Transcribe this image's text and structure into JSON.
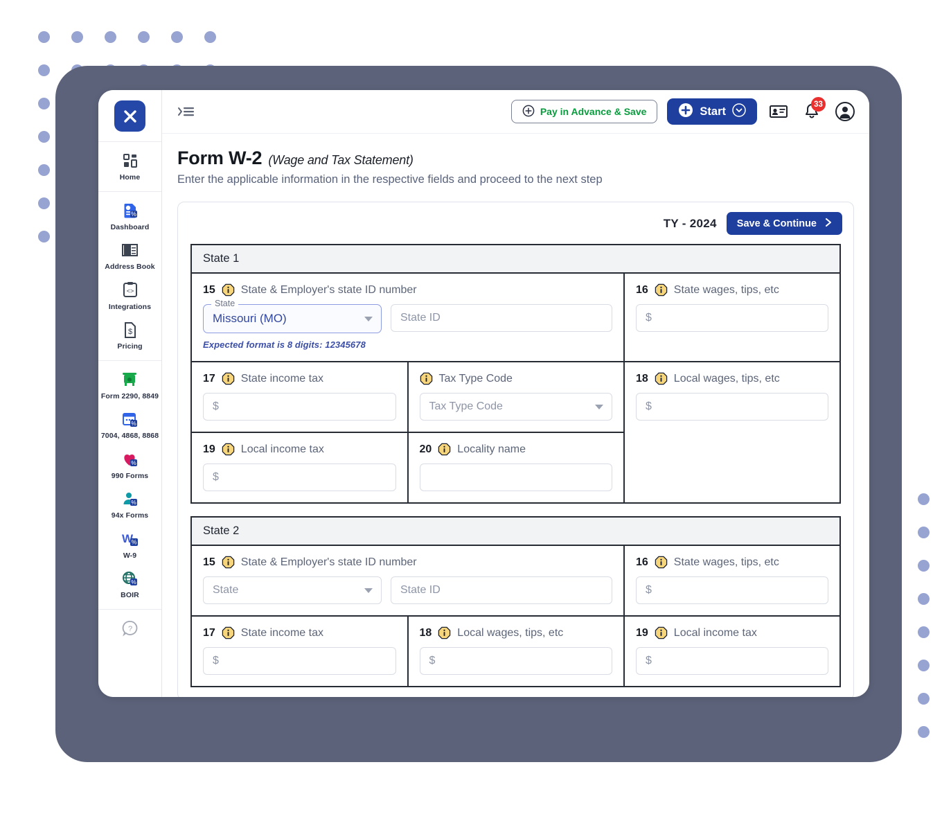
{
  "brand": {
    "logo_text": "X",
    "logo_color": "#2547a8"
  },
  "colors": {
    "accent_blue": "#1e3f9e",
    "green": "#0a9b3e",
    "badge_red": "#ea2f2f",
    "bezel": "#5b6279",
    "dot": "#97a3d0",
    "info_yellow": "#f7d57a"
  },
  "sidebar": {
    "groups": [
      {
        "items": [
          {
            "label": "Home",
            "icon": "grid-icon"
          }
        ]
      },
      {
        "items": [
          {
            "label": "Dashboard",
            "icon": "dashboard-document-icon"
          },
          {
            "label": "Address Book",
            "icon": "address-book-icon"
          },
          {
            "label": "Integrations",
            "icon": "code-clipboard-icon"
          },
          {
            "label": "Pricing",
            "icon": "price-tag-document-icon"
          }
        ]
      },
      {
        "items": [
          {
            "label": "Form 2290, 8849",
            "icon": "truck-icon"
          },
          {
            "label": "7004, 4868, 8868",
            "icon": "calendar-icon"
          },
          {
            "label": "990 Forms",
            "icon": "heart-icon"
          },
          {
            "label": "94x Forms",
            "icon": "person-tie-icon"
          },
          {
            "label": "W-9",
            "icon": "w-letter-icon"
          },
          {
            "label": "BOIR",
            "icon": "globe-icon"
          }
        ]
      },
      {
        "items": [
          {
            "label": "",
            "icon": "help-chat-icon"
          }
        ]
      }
    ]
  },
  "topbar": {
    "collapse_icon": "collapse-sidebar-icon",
    "pay_in_advance_label": "Pay in Advance & Save",
    "start_label": "Start",
    "id_card_icon": "id-card-icon",
    "bell_icon": "bell-icon",
    "notification_count": "33",
    "avatar_icon": "user-avatar-icon"
  },
  "page": {
    "title": "Form W-2",
    "title_sub": "(Wage and Tax Statement)",
    "description": "Enter the applicable information in the respective fields and proceed to the next step"
  },
  "card_header": {
    "tax_year": "TY - 2024",
    "save_continue_label": "Save & Continue"
  },
  "state_blocks": [
    {
      "heading": "State 1",
      "f15": {
        "num": "15",
        "label": "State & Employer's state ID number",
        "state_legend": "State",
        "state_value": "Missouri (MO)",
        "state_id_placeholder": "State ID",
        "hint": "Expected format is 8 digits: 12345678"
      },
      "f16": {
        "num": "16",
        "label": "State wages, tips, etc",
        "placeholder": "$"
      },
      "f17": {
        "num": "17",
        "label": "State income tax",
        "placeholder": "$"
      },
      "tax_type": {
        "num": "",
        "label": "Tax Type Code",
        "placeholder": "Tax Type Code"
      },
      "f18": {
        "num": "18",
        "label": "Local wages, tips, etc",
        "placeholder": "$"
      },
      "f19": {
        "num": "19",
        "label": "Local income tax",
        "placeholder": "$"
      },
      "f20": {
        "num": "20",
        "label": "Locality name",
        "placeholder": ""
      }
    },
    {
      "heading": "State 2",
      "f15": {
        "num": "15",
        "label": "State & Employer's state ID number",
        "state_placeholder": "State",
        "state_id_placeholder": "State ID"
      },
      "f16": {
        "num": "16",
        "label": "State wages, tips, etc",
        "placeholder": "$"
      },
      "f17": {
        "num": "17",
        "label": "State income tax",
        "placeholder": "$"
      },
      "f18": {
        "num": "18",
        "label": "Local wages, tips, etc",
        "placeholder": "$"
      },
      "f19": {
        "num": "19",
        "label": "Local income tax",
        "placeholder": "$"
      }
    }
  ]
}
